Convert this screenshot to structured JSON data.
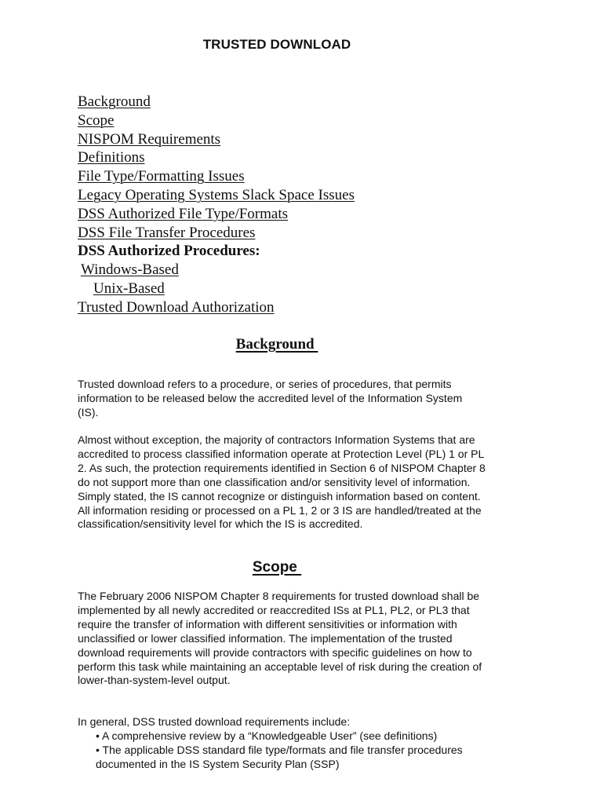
{
  "document": {
    "title": "TRUSTED DOWNLOAD",
    "toc": [
      {
        "label": "Background",
        "style": "link"
      },
      {
        "label": "Scope",
        "style": "link"
      },
      {
        "label": "NISPOM Requirements",
        "style": "link"
      },
      {
        "label": "Definitions",
        "style": "link"
      },
      {
        "label": "File Type/Formatting Issues",
        "style": "link"
      },
      {
        "label": "Legacy Operating Systems Slack Space Issues",
        "style": "link"
      },
      {
        "label": "DSS Authorized File Type/Formats",
        "style": "link"
      },
      {
        "label": "DSS File Transfer Procedures",
        "style": "link"
      },
      {
        "label": "DSS Authorized Procedures:",
        "style": "bold"
      },
      {
        "label": "Windows-Based",
        "style": "link"
      },
      {
        "label": "Unix-Based",
        "style": "link"
      },
      {
        "label": "Trusted Download Authorization",
        "style": "link"
      }
    ],
    "background": {
      "heading": "Background ",
      "paragraphs": [
        "Trusted download refers to a procedure, or series of procedures, that permits information to be released below the accredited level of the Information System (IS).",
        "Almost without exception, the majority of contractors Information Systems that are accredited to process classified information operate at Protection Level (PL) 1 or PL 2.  As such, the protection requirements identified in Section 6 of NISPOM Chapter 8 do not support more than one classification and/or sensitivity level of information.  Simply stated, the IS cannot recognize or distinguish information based on content.  All information residing or processed on a PL 1, 2 or 3 IS are handled/treated at the classification/sensitivity level for which the IS is accredited."
      ]
    },
    "scope": {
      "heading": "Scope ",
      "paragraphs": [
        "The February 2006 NISPOM Chapter 8 requirements for trusted download shall be implemented by all newly accredited or reaccredited ISs at PL1, PL2, or PL3 that require the transfer of information with different sensitivities or information with unclassified or lower classified information. The implementation of the trusted download requirements will provide contractors with specific guidelines on how to perform this task while maintaining an acceptable level of risk during the creation of lower-than-system-level output.",
        "In general, DSS trusted download requirements include:"
      ],
      "bullets": [
        "• A comprehensive review by a “Knowledgeable User” (see definitions)",
        "• The applicable DSS standard  file type/formats and file transfer procedures documented in the IS System Security Plan (SSP)"
      ]
    }
  }
}
